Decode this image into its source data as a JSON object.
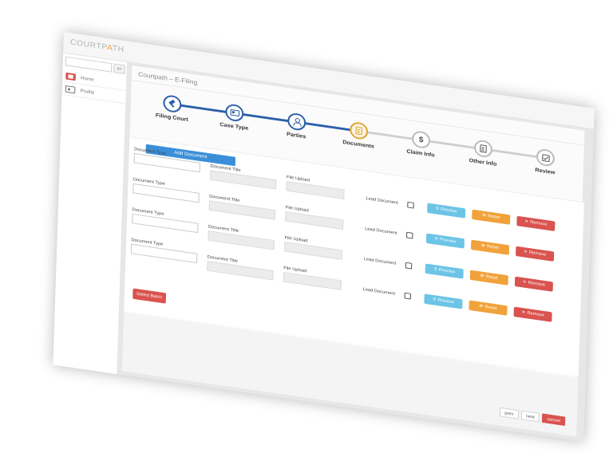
{
  "app": {
    "logo_prefix": "COURTP",
    "logo_accent": "A",
    "logo_suffix": "TH"
  },
  "sidebar": {
    "search_placeholder": "",
    "search_button": "go",
    "items": [
      {
        "label": "Home",
        "icon": "home-icon"
      },
      {
        "label": "Profile",
        "icon": "profile-icon"
      }
    ]
  },
  "main": {
    "title": "Courtpath – E-Filing"
  },
  "stepper": {
    "steps": [
      {
        "label": "Filing Court",
        "state": "done",
        "icon": "gavel-icon"
      },
      {
        "label": "Case Type",
        "state": "done",
        "icon": "case-type-icon"
      },
      {
        "label": "Parties",
        "state": "done",
        "icon": "person-icon"
      },
      {
        "label": "Documents",
        "state": "current",
        "icon": "document-icon"
      },
      {
        "label": "Claim Info",
        "state": "todo",
        "icon": "dollar-icon",
        "glyph": "$"
      },
      {
        "label": "Other Info",
        "state": "todo",
        "icon": "file-icon"
      },
      {
        "label": "Review",
        "state": "todo",
        "icon": "checkbox-icon"
      }
    ],
    "colors": {
      "done": "#2a5fa8",
      "current": "#e0a437",
      "todo": "#bbbbbb"
    }
  },
  "documents": {
    "add_button": "Add Document",
    "labels": {
      "type": "Document Type",
      "title": "Document Title",
      "upload": "File Upload",
      "lead": "Lead Document"
    },
    "rows": [
      {
        "lead_checked": false
      },
      {
        "lead_checked": false
      },
      {
        "lead_checked": false
      },
      {
        "lead_checked": false
      }
    ],
    "actions": {
      "preview": "Preview",
      "reset": "Reset",
      "remove": "Remove"
    },
    "select_button": "Select Batch"
  },
  "footer": {
    "prev": "prev",
    "next": "next",
    "cancel": "cancel"
  },
  "colors": {
    "accent": "#3a8fd8",
    "preview": "#6cc4e6",
    "reset": "#f1a23a",
    "remove": "#d9534f"
  }
}
